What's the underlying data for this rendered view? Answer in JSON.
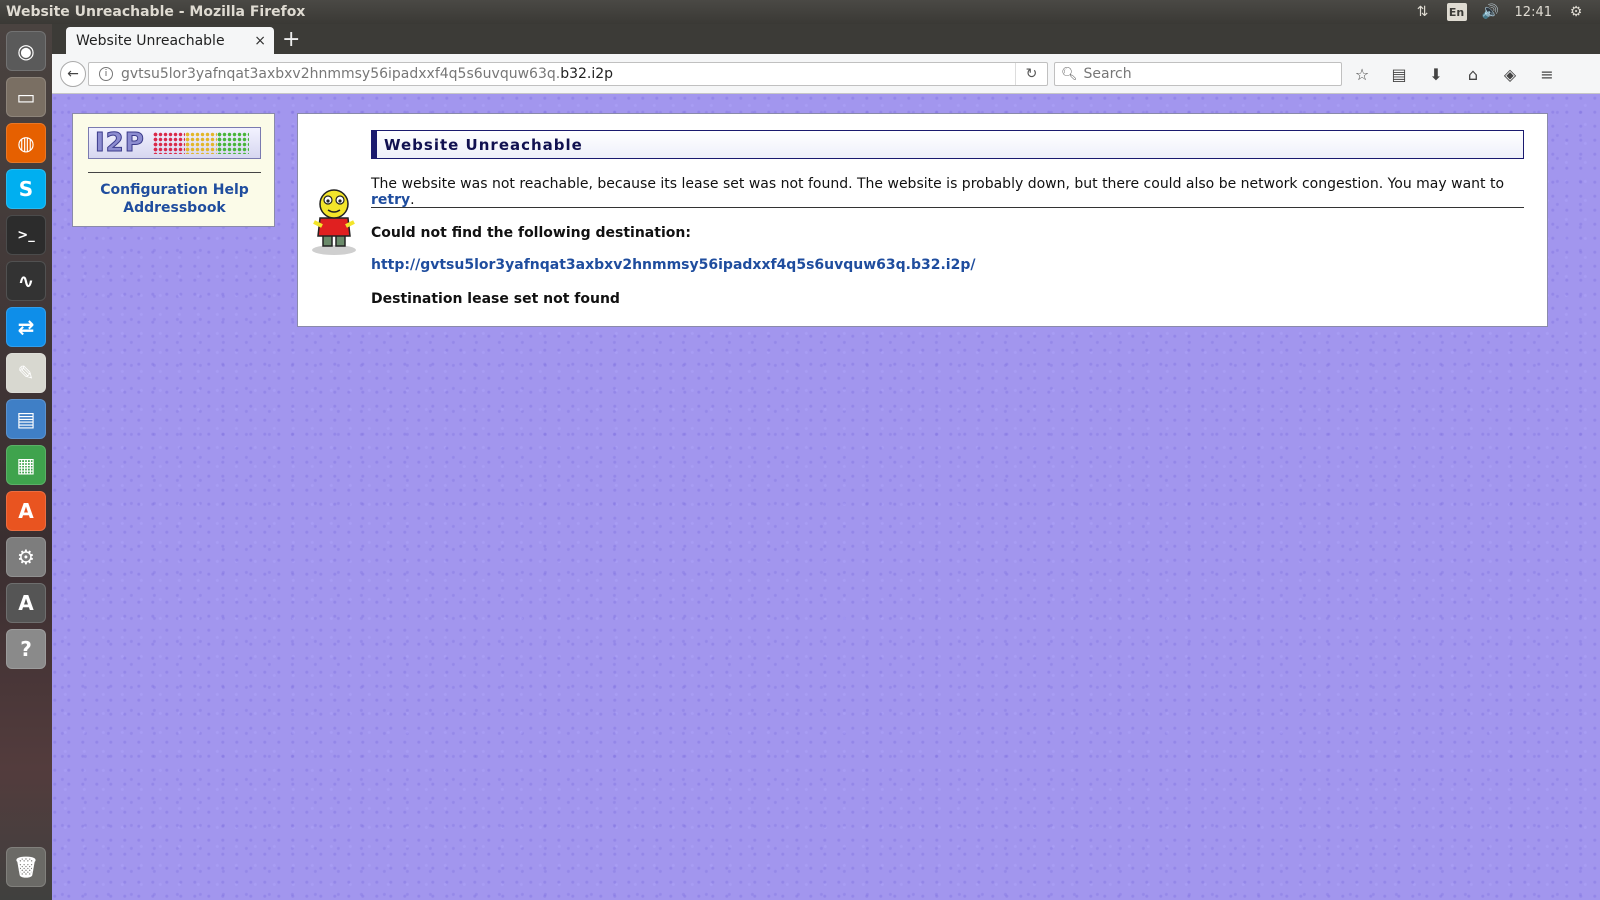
{
  "system": {
    "window_title": "Website Unreachable - Mozilla Firefox",
    "keyboard_layout": "En",
    "clock": "12:41"
  },
  "launcher": {
    "items": [
      {
        "name": "ubuntu-dash-icon",
        "glyph": "◉",
        "color": "#5a5a5a"
      },
      {
        "name": "files-icon",
        "glyph": "▭",
        "color": "#7a6f63"
      },
      {
        "name": "firefox-icon",
        "glyph": "◍",
        "color": "#e66000"
      },
      {
        "name": "skype-icon",
        "glyph": "S",
        "color": "#00aff0"
      },
      {
        "name": "terminal-icon",
        "glyph": ">_",
        "color": "#2c2c2c"
      },
      {
        "name": "system-monitor-icon",
        "glyph": "∿",
        "color": "#333333"
      },
      {
        "name": "teamviewer-icon",
        "glyph": "⇄",
        "color": "#0e8ee9"
      },
      {
        "name": "text-editor-icon",
        "glyph": "✎",
        "color": "#d8d8d0"
      },
      {
        "name": "writer-icon",
        "glyph": "▤",
        "color": "#3f7fc6"
      },
      {
        "name": "calc-icon",
        "glyph": "▦",
        "color": "#3fa34d"
      },
      {
        "name": "software-center-icon",
        "glyph": "A",
        "color": "#e95420"
      },
      {
        "name": "system-settings-icon",
        "glyph": "⚙",
        "color": "#7d7d7d"
      },
      {
        "name": "software-updater-icon",
        "glyph": "A",
        "color": "#555555"
      },
      {
        "name": "help-icon",
        "glyph": "?",
        "color": "#8a8a8a"
      }
    ],
    "trash_glyph": "🗑"
  },
  "browser": {
    "tab_title": "Website Unreachable",
    "tab_close": "×",
    "new_tab": "+",
    "url_prefix": "gvtsu5lor3yafnqat3axbxv2hnmmsy56ipadxxf4q5s6uvquw63q.",
    "url_domain": "b32.i2p",
    "search_placeholder": "Search"
  },
  "sidebar": {
    "logo_text": "I2P",
    "links": [
      "Configuration Help",
      "Addressbook"
    ]
  },
  "main": {
    "title": "Website Unreachable",
    "message_before": "The website was not reachable, because its lease set was not found. The website is probably down, but there could also be network congestion. You may want to ",
    "retry_link": "retry",
    "message_after": ".",
    "destination_label": "Could not find the following destination:",
    "destination_url": "http://gvtsu5lor3yafnqat3axbxv2hnmmsy56ipadxxf4q5s6uvquw63q.b32.i2p/",
    "error_detail": "Destination lease set not found"
  }
}
